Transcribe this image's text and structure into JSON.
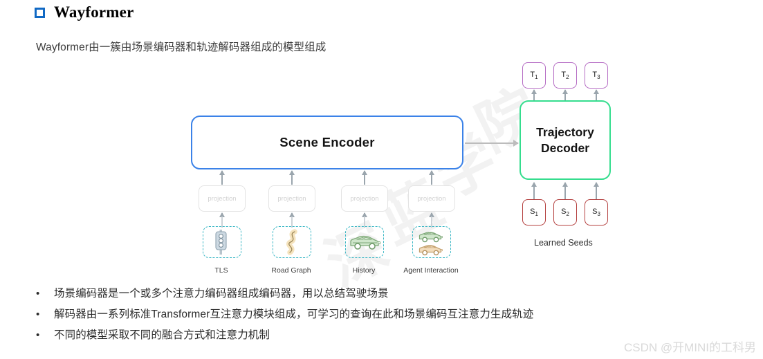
{
  "header": {
    "title": "Wayformer",
    "bullet_icon": "blue-square-icon"
  },
  "subtitle": "Wayformer由一簇由场景编码器和轨迹解码器组成的模型组成",
  "diagram": {
    "scene_encoder": {
      "label": "Scene Encoder",
      "border_color": "#3b82e8"
    },
    "trajectory_decoder": {
      "line1": "Trajectory",
      "line2": "Decoder",
      "border_color": "#35dd8e"
    },
    "outputs": {
      "border_color": "#b56cc4",
      "items": [
        {
          "base": "T",
          "sub": "1"
        },
        {
          "base": "T",
          "sub": "2"
        },
        {
          "base": "T",
          "sub": "3"
        }
      ]
    },
    "seeds": {
      "border_color": "#b4403f",
      "caption": "Learned Seeds",
      "items": [
        {
          "base": "S",
          "sub": "1"
        },
        {
          "base": "S",
          "sub": "2"
        },
        {
          "base": "S",
          "sub": "3"
        }
      ]
    },
    "projections": [
      {
        "label": "projection"
      },
      {
        "label": "projection"
      },
      {
        "label": "projection"
      },
      {
        "label": "projection"
      }
    ],
    "inputs": [
      {
        "caption": "TLS",
        "icon": "traffic-light-icon"
      },
      {
        "caption": "Road Graph",
        "icon": "winding-road-icon"
      },
      {
        "caption": "History",
        "icon": "car-icon"
      },
      {
        "caption": "Agent Interaction",
        "icon": "two-cars-icon"
      }
    ]
  },
  "bullets": [
    {
      "marker": "•",
      "text": "场景编码器是一个或多个注意力编码器组成编码器，用以总结驾驶场景"
    },
    {
      "marker": "•",
      "text": "解码器由一系列标准Transformer互注意力模块组成，可学习的查询在此和场景编码互注意力生成轨迹"
    },
    {
      "marker": "•",
      "text": "不同的模型采取不同的融合方式和注意力机制"
    }
  ],
  "watermark": {
    "csdn": "CSDN @开MINI的工科男",
    "bg_chars": [
      "深",
      "蓝",
      "学",
      "院"
    ]
  }
}
